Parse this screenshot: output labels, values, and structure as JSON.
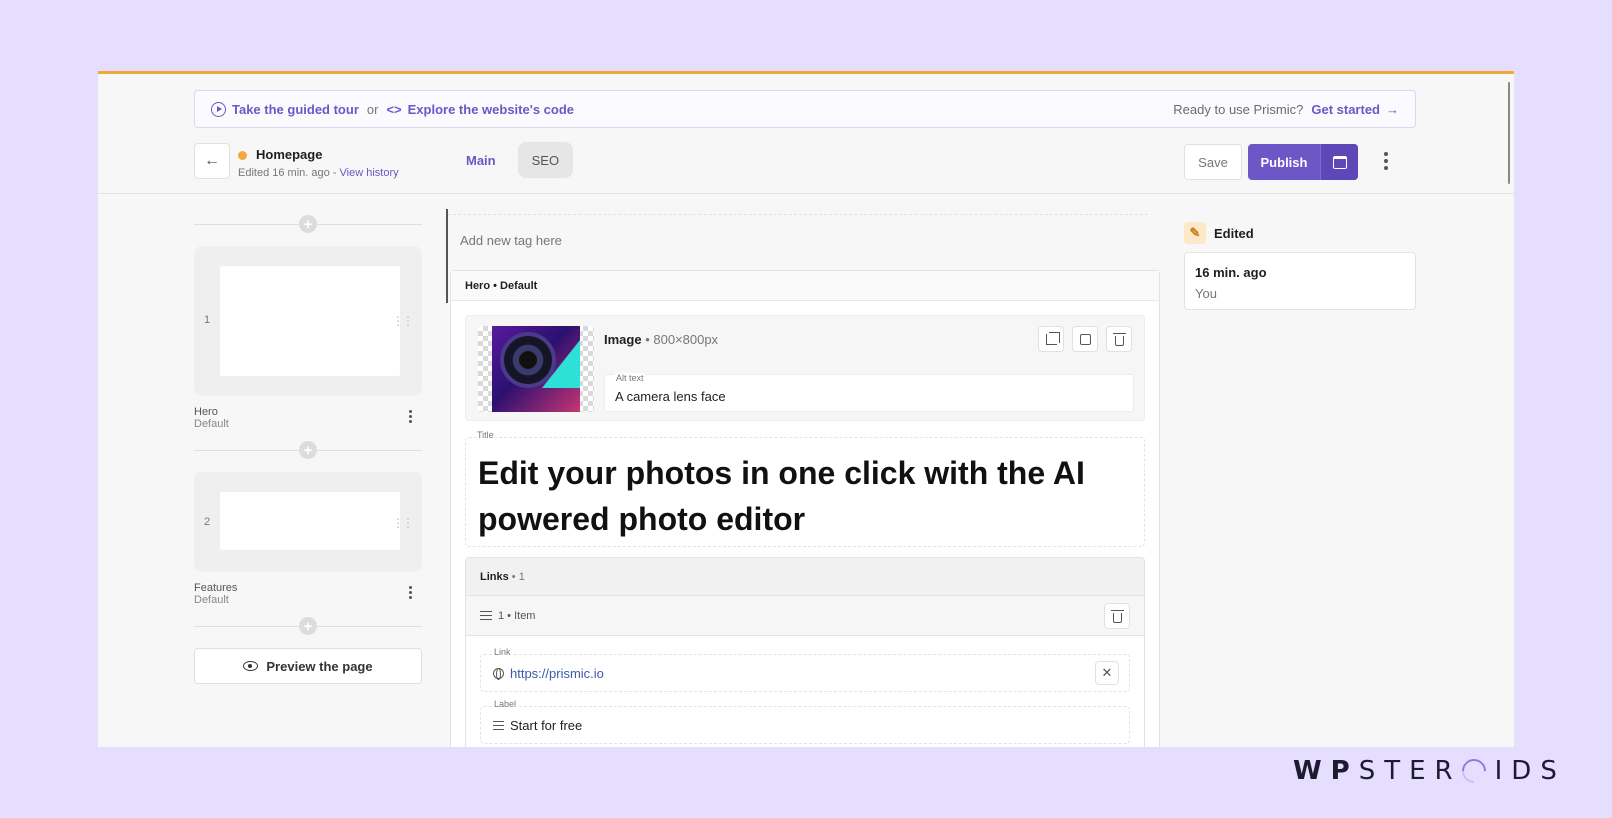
{
  "banner": {
    "tour_label": "Take the guided tour",
    "or_label": "or",
    "code_label": "Explore the website's code",
    "ready_label": "Ready to use Prismic?",
    "get_started_label": "Get started"
  },
  "header": {
    "doc_title": "Homepage",
    "edited_label": "Edited 16 min. ago - ",
    "history_label": "View history",
    "tabs": [
      {
        "label": "Main",
        "active": true
      },
      {
        "label": "SEO",
        "active": false
      }
    ],
    "save_label": "Save",
    "publish_label": "Publish"
  },
  "slices": [
    {
      "index": "1",
      "name": "Hero",
      "variation": "Default"
    },
    {
      "index": "2",
      "name": "Features",
      "variation": "Default"
    }
  ],
  "preview_label": "Preview the page",
  "editor": {
    "tag_placeholder": "Add new tag here",
    "slice_header": "Hero • Default",
    "image": {
      "label": "Image",
      "dimensions": " • 800×800px",
      "alt_label": "Alt text",
      "alt_value": "A camera lens face"
    },
    "title": {
      "label": "Title",
      "value": "Edit your photos in one click with the AI powered photo editor"
    },
    "links": {
      "label": "Links",
      "count": " • 1",
      "item_label": "1 • Item",
      "link_label": "Link",
      "link_value": "https://prismic.io",
      "label_label": "Label",
      "label_value": "Start for free"
    }
  },
  "status": {
    "label": "Edited",
    "time": "16 min. ago",
    "user": "You"
  },
  "watermark": {
    "bold": "WP",
    "rest_a": "STER",
    "rest_b": "IDS"
  },
  "colors": {
    "accent": "#6b57c6",
    "top_border": "#f2a93b",
    "background": "#e5defe"
  }
}
